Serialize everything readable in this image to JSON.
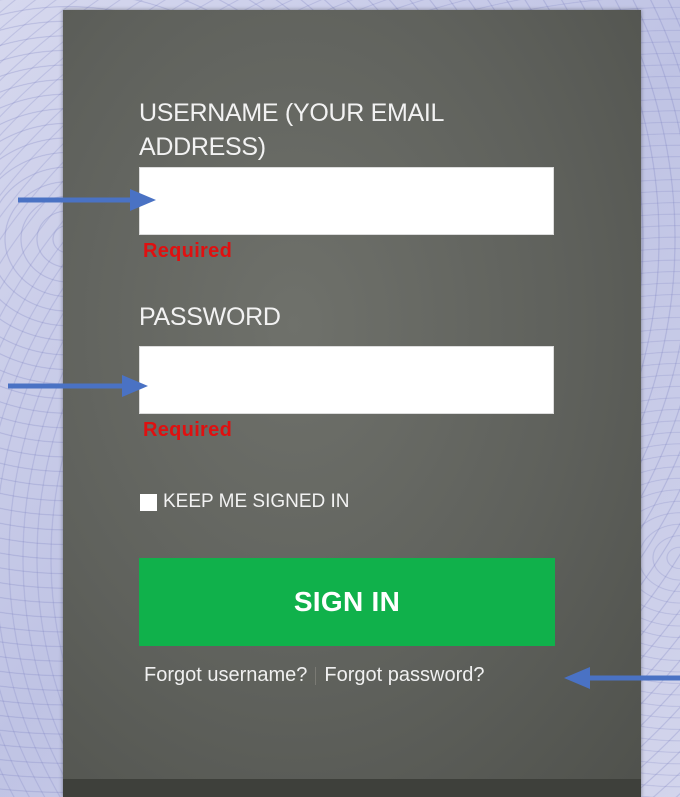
{
  "form": {
    "username_label": "USERNAME (YOUR EMAIL ADDRESS)",
    "username_value": "",
    "username_error": "Required",
    "password_label": "PASSWORD",
    "password_value": "",
    "password_error": "Required",
    "keep_signed_in_label": "KEEP ME SIGNED IN",
    "keep_signed_in_checked": false,
    "signin_label": "SIGN IN",
    "forgot_username": "Forgot username?",
    "forgot_password": "Forgot password?"
  },
  "colors": {
    "panel": "#5f615c",
    "signin_button": "#10b14b",
    "error_text": "#e01010",
    "arrow": "#4a72c4",
    "background": "#c9cde8"
  },
  "annotations": {
    "arrows": [
      "arrow-icon",
      "arrow-icon",
      "arrow-icon"
    ]
  }
}
